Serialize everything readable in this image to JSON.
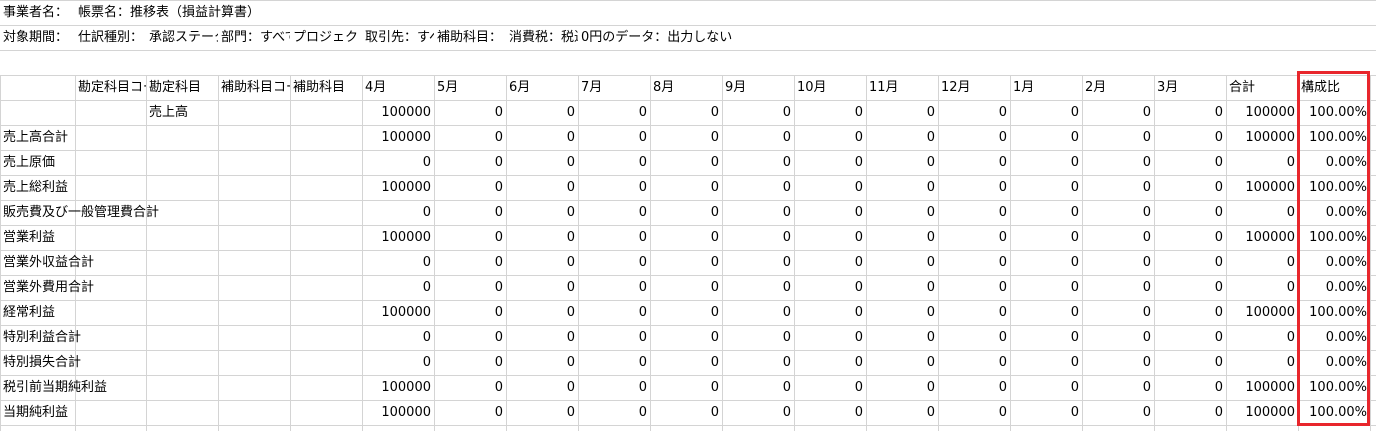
{
  "meta_rows": [
    [
      "事業者名：",
      "帳票名：推移表（損益計算書）"
    ],
    [
      "対象期間：",
      "仕訳種別：",
      "承認ステータス：",
      "部門：すべて",
      "プロジェクト：",
      "取引先：すべて",
      "補助科目：",
      "消費税：税込",
      "0円のデータ：出力しない"
    ]
  ],
  "headers": [
    "",
    "勘定科目コード",
    "勘定科目",
    "補助科目コード",
    "補助科目",
    "4月",
    "5月",
    "6月",
    "7月",
    "8月",
    "9月",
    "10月",
    "11月",
    "12月",
    "1月",
    "2月",
    "3月",
    "合計",
    "構成比"
  ],
  "rows": [
    [
      "",
      "",
      "売上高",
      "",
      "",
      "100000",
      "0",
      "0",
      "0",
      "0",
      "0",
      "0",
      "0",
      "0",
      "0",
      "0",
      "0",
      "100000",
      "100.00%"
    ],
    [
      "売上高合計",
      "",
      "",
      "",
      "",
      "100000",
      "0",
      "0",
      "0",
      "0",
      "0",
      "0",
      "0",
      "0",
      "0",
      "0",
      "0",
      "100000",
      "100.00%"
    ],
    [
      "売上原価",
      "",
      "",
      "",
      "",
      "0",
      "0",
      "0",
      "0",
      "0",
      "0",
      "0",
      "0",
      "0",
      "0",
      "0",
      "0",
      "0",
      "0.00%"
    ],
    [
      "売上総利益",
      "",
      "",
      "",
      "",
      "100000",
      "0",
      "0",
      "0",
      "0",
      "0",
      "0",
      "0",
      "0",
      "0",
      "0",
      "0",
      "100000",
      "100.00%"
    ],
    [
      "販売費及び一般管理費合計",
      "",
      "",
      "",
      "",
      "0",
      "0",
      "0",
      "0",
      "0",
      "0",
      "0",
      "0",
      "0",
      "0",
      "0",
      "0",
      "0",
      "0.00%"
    ],
    [
      "営業利益",
      "",
      "",
      "",
      "",
      "100000",
      "0",
      "0",
      "0",
      "0",
      "0",
      "0",
      "0",
      "0",
      "0",
      "0",
      "0",
      "100000",
      "100.00%"
    ],
    [
      "営業外収益合計",
      "",
      "",
      "",
      "",
      "0",
      "0",
      "0",
      "0",
      "0",
      "0",
      "0",
      "0",
      "0",
      "0",
      "0",
      "0",
      "0",
      "0.00%"
    ],
    [
      "営業外費用合計",
      "",
      "",
      "",
      "",
      "0",
      "0",
      "0",
      "0",
      "0",
      "0",
      "0",
      "0",
      "0",
      "0",
      "0",
      "0",
      "0",
      "0.00%"
    ],
    [
      "経常利益",
      "",
      "",
      "",
      "",
      "100000",
      "0",
      "0",
      "0",
      "0",
      "0",
      "0",
      "0",
      "0",
      "0",
      "0",
      "0",
      "100000",
      "100.00%"
    ],
    [
      "特別利益合計",
      "",
      "",
      "",
      "",
      "0",
      "0",
      "0",
      "0",
      "0",
      "0",
      "0",
      "0",
      "0",
      "0",
      "0",
      "0",
      "0",
      "0.00%"
    ],
    [
      "特別損失合計",
      "",
      "",
      "",
      "",
      "0",
      "0",
      "0",
      "0",
      "0",
      "0",
      "0",
      "0",
      "0",
      "0",
      "0",
      "0",
      "0",
      "0.00%"
    ],
    [
      "税引前当期純利益",
      "",
      "",
      "",
      "",
      "100000",
      "0",
      "0",
      "0",
      "0",
      "0",
      "0",
      "0",
      "0",
      "0",
      "0",
      "0",
      "100000",
      "100.00%"
    ],
    [
      "当期純利益",
      "",
      "",
      "",
      "",
      "100000",
      "0",
      "0",
      "0",
      "0",
      "0",
      "0",
      "0",
      "0",
      "0",
      "0",
      "0",
      "100000",
      "100.00%"
    ]
  ],
  "highlight_color": "#e8262c",
  "grid_color": "#d4d4d4"
}
